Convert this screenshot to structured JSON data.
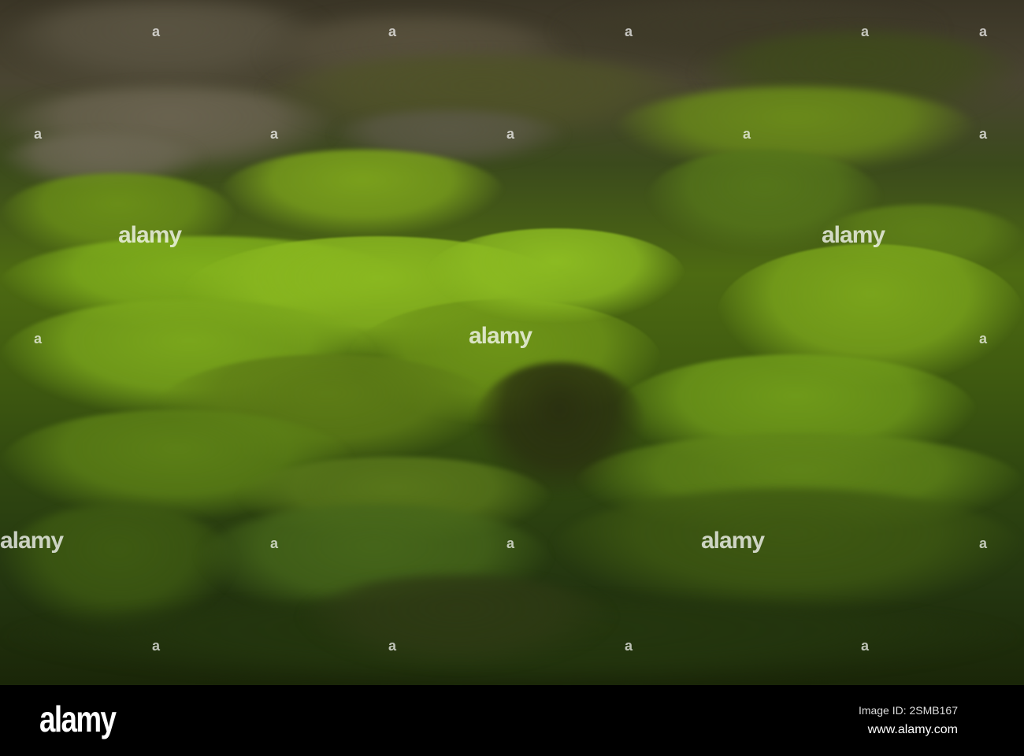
{
  "photo": {
    "subject": "moss-covered rocks",
    "colors": {
      "moss": "#7fae1c",
      "rock": "#4a4434",
      "shadow": "#1a2208"
    }
  },
  "watermark": {
    "text": "alamy"
  },
  "footer": {
    "logo": "alamy",
    "image_id": "Image ID: 2SMB167",
    "website": "www.alamy.com"
  }
}
